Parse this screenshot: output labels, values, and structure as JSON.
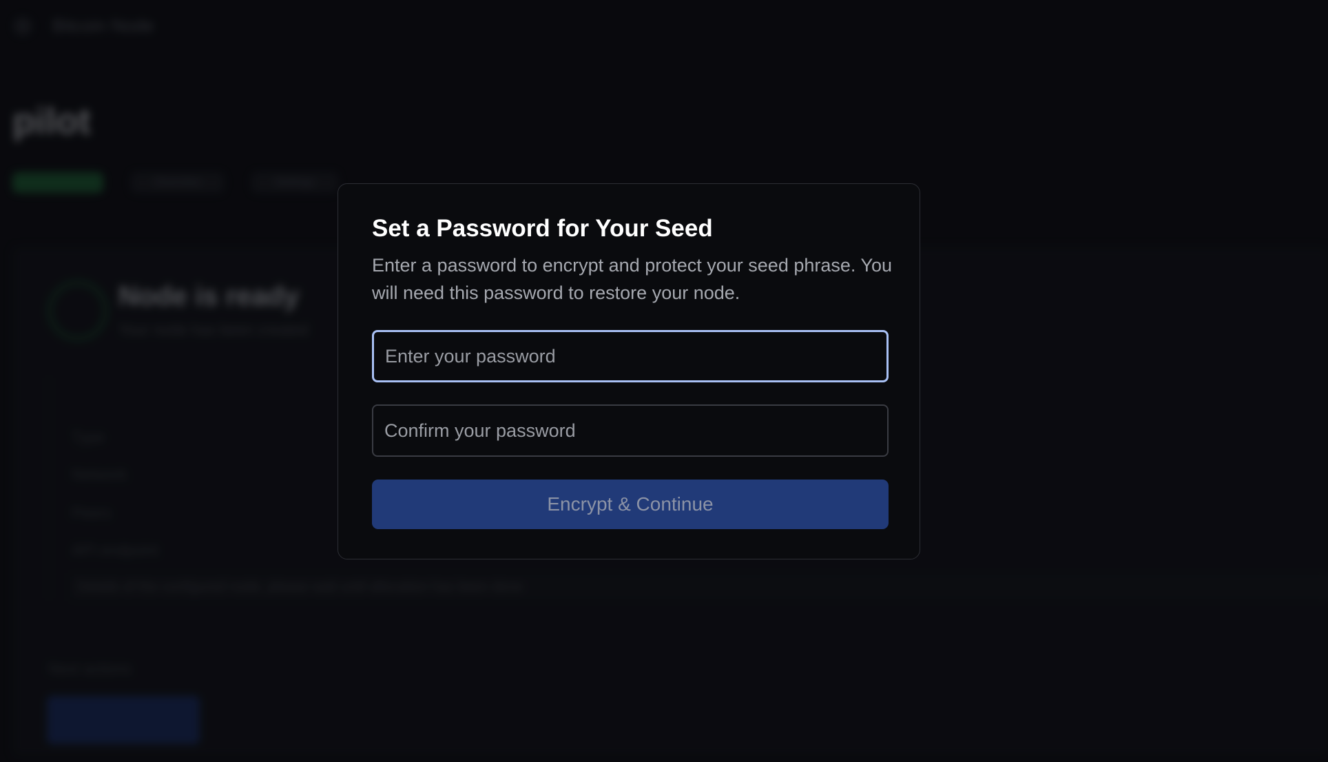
{
  "background": {
    "topbar_title": "Bitcoin Node",
    "app_title": "pilot",
    "pills": [
      "running",
      "Overview",
      "Settings"
    ],
    "status_title": "Node is ready",
    "status_subtitle": "Your node has been created",
    "info_rows": [
      "Type",
      "Network",
      "Peers",
      "API endpoint"
    ],
    "long_line": "Details of the configured node, please wait until allocation has been done",
    "footer_label": "Next actions"
  },
  "modal": {
    "title": "Set a Password for Your Seed",
    "description": "Enter a password to encrypt and protect your seed phrase. You will need this password to restore your node.",
    "password_placeholder": "Enter your password",
    "confirm_placeholder": "Confirm your password",
    "submit_label": "Encrypt & Continue"
  },
  "colors": {
    "accent": "#213a78",
    "focus_ring": "#a9c1f5",
    "background": "#0b0c10"
  },
  "icons": {
    "back": "back-arrow-icon",
    "status": "check-circle-icon"
  }
}
